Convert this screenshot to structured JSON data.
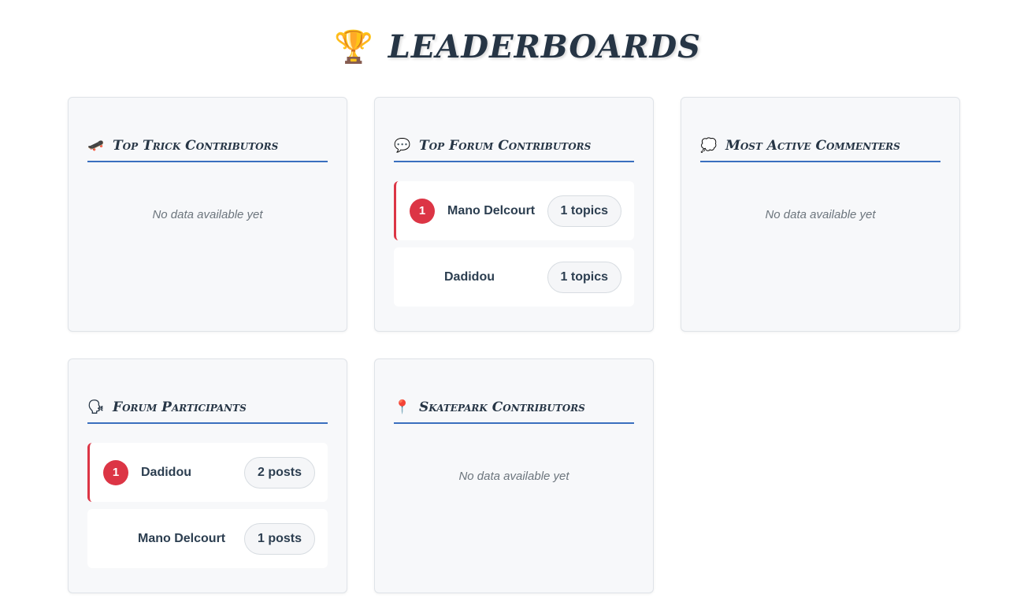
{
  "page": {
    "title": "LEADERBOARDS",
    "title_icon": "trophy-icon"
  },
  "cards": {
    "trick": {
      "icon": "skateboard-icon",
      "title": "Top Trick Contributors",
      "empty": "No data available yet"
    },
    "forum": {
      "icon": "speech-bubble-icon",
      "title": "Top Forum Contributors",
      "rows": [
        {
          "rank": "1",
          "name": "Mano Delcourt",
          "count": "1 topics"
        },
        {
          "rank": "",
          "name": "Dadidou",
          "count": "1 topics"
        }
      ]
    },
    "commenters": {
      "icon": "thought-bubble-icon",
      "title": "Most Active Commenters",
      "empty": "No data available yet"
    },
    "participants": {
      "icon": "speaking-head-icon",
      "title": "Forum Participants",
      "rows": [
        {
          "rank": "1",
          "name": "Dadidou",
          "count": "2 posts"
        },
        {
          "rank": "",
          "name": "Mano Delcourt",
          "count": "1 posts"
        }
      ]
    },
    "skatepark": {
      "icon": "pushpin-icon",
      "title": "Skatepark Contributors",
      "empty": "No data available yet"
    }
  },
  "colors": {
    "accent_line": "#3a6fbf",
    "rank_badge": "#dc3545",
    "title_text": "#263545"
  }
}
